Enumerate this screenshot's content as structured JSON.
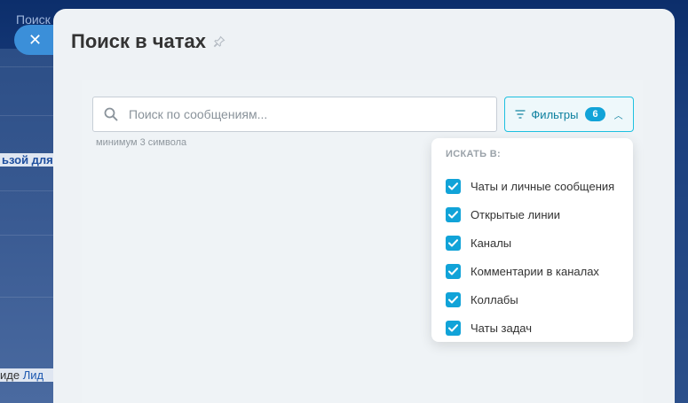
{
  "background": {
    "top_text": "Поиск",
    "left_text_1": "ьзой для",
    "left_text_2_prefix": "иде ",
    "left_text_2_link": "Лид"
  },
  "slider": {
    "title": "Поиск в чатах"
  },
  "search": {
    "placeholder": "Поиск по сообщениям...",
    "value": "",
    "hint": "минимум 3 символа"
  },
  "filter": {
    "label": "Фильтры",
    "count": "6"
  },
  "dropdown": {
    "heading": "ИСКАТЬ В:",
    "items": [
      {
        "label": "Чаты и личные сообщения",
        "checked": true
      },
      {
        "label": "Открытые линии",
        "checked": true
      },
      {
        "label": "Каналы",
        "checked": true
      },
      {
        "label": "Комментарии в каналах",
        "checked": true
      },
      {
        "label": "Коллабы",
        "checked": true
      },
      {
        "label": "Чаты задач",
        "checked": true
      }
    ]
  },
  "colors": {
    "accent": "#11a3d8",
    "close_button": "#3b8fd9",
    "panel_bg": "#eef2f5"
  },
  "icons": {
    "close": "close-icon",
    "pin": "pin-icon",
    "search": "search-icon",
    "filter": "filter-icon",
    "chevron": "chevron-up-icon",
    "check": "checkmark-icon"
  }
}
